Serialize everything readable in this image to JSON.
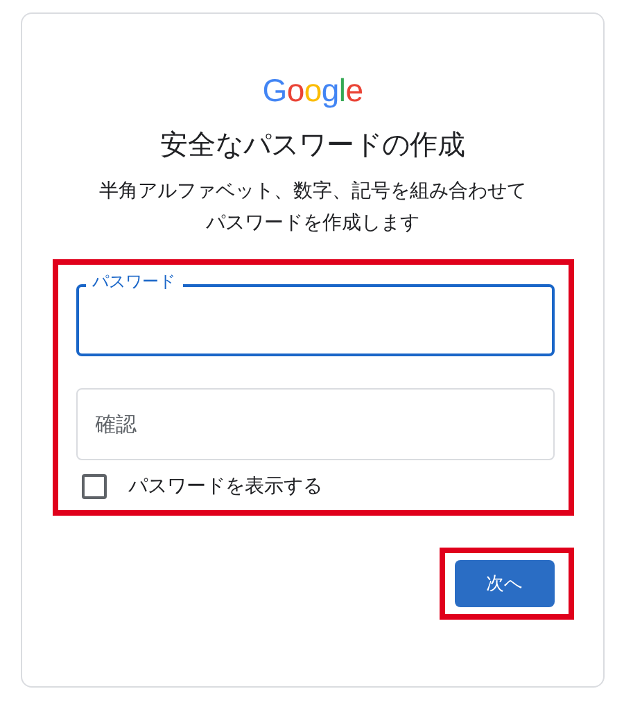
{
  "logo": {
    "text": "Google"
  },
  "title": "安全なパスワードの作成",
  "subtitle": [
    "半角アルファベット、数字、記号を組み合わせて",
    "パスワードを作成します"
  ],
  "form": {
    "highlighted": true,
    "fields": [
      {
        "label": "パスワード",
        "focused": true
      },
      {
        "placeholder": "確認",
        "focused": false
      }
    ],
    "show_password": {
      "label": "パスワードを表示する",
      "checked": false
    }
  },
  "next_button": {
    "label": "次へ",
    "highlighted": true
  }
}
